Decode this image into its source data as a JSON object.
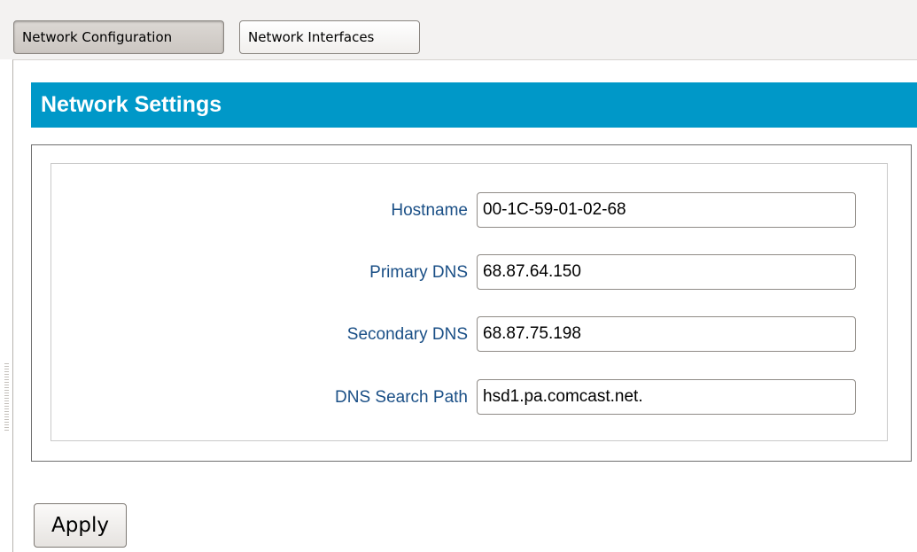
{
  "tabs": [
    {
      "label": "Network Configuration",
      "active": true
    },
    {
      "label": "Network Interfaces",
      "active": false
    }
  ],
  "section": {
    "title": "Network Settings"
  },
  "fields": {
    "hostname": {
      "label": "Hostname",
      "value": "00-1C-59-01-02-68"
    },
    "primary_dns": {
      "label": "Primary DNS",
      "value": "68.87.64.150"
    },
    "secondary_dns": {
      "label": "Secondary DNS",
      "value": "68.87.75.198"
    },
    "dns_search_path": {
      "label": "DNS Search Path",
      "value": "hsd1.pa.comcast.net."
    }
  },
  "actions": {
    "apply_label": "Apply"
  },
  "colors": {
    "header_bg": "#0098c8",
    "label_text": "#1a4f86"
  }
}
